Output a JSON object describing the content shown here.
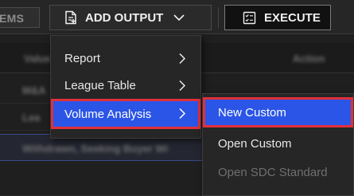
{
  "toolbar": {
    "items_label": "EMS",
    "add_output_label": "ADD OUTPUT",
    "execute_label": "EXECUTE"
  },
  "background": {
    "col_value": "Value",
    "col_action": "Action",
    "rows": [
      "M&A",
      "Lea",
      "Withdrawn, Seeking Buyer Wi"
    ]
  },
  "add_output_menu": {
    "items": [
      {
        "label": "Report"
      },
      {
        "label": "League Table"
      },
      {
        "label": "Volume Analysis"
      }
    ]
  },
  "volume_analysis_submenu": {
    "items": [
      {
        "label": "New Custom"
      },
      {
        "label": "Open Custom"
      },
      {
        "label": "Open SDC Standard"
      }
    ]
  },
  "colors": {
    "highlight": "#2b55e6",
    "focus_outline": "#e0303a",
    "menu_bg": "#262626"
  }
}
